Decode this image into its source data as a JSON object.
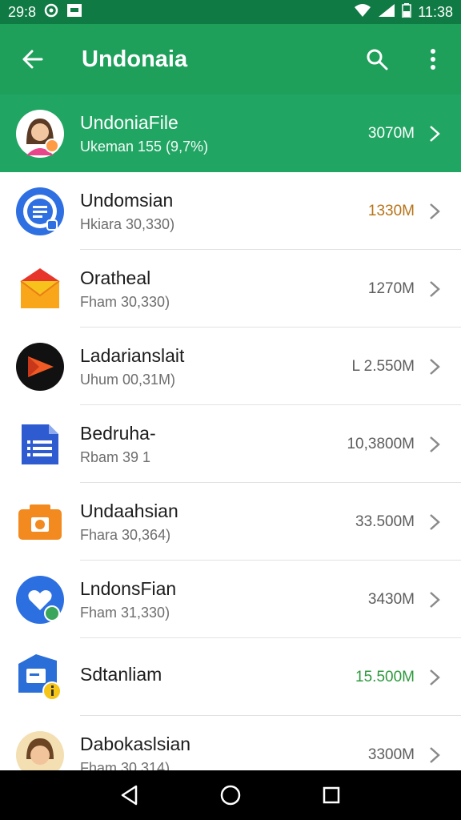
{
  "status": {
    "time_left": "29:8",
    "time_right": "11:38"
  },
  "appbar": {
    "title": "Undonaia"
  },
  "featured": {
    "name": "UndoniaFile",
    "subtitle": "Ukeman 155 (9,7%)",
    "size": "3070M"
  },
  "items": [
    {
      "name": "Undomsian",
      "subtitle": "Hkiara 30,330)",
      "size": "1330M",
      "size_color": "#b8741a",
      "icon": "chat-bubble-icon"
    },
    {
      "name": "Oratheal",
      "subtitle": "Fham 30,330)",
      "size": "1270M",
      "size_color": "#5d5d5d",
      "icon": "mail-envelope-icon"
    },
    {
      "name": "Ladarianslait",
      "subtitle": "Uhum 00,31M)",
      "size": "L 2.550M",
      "size_color": "#5d5d5d",
      "icon": "play-triangle-icon"
    },
    {
      "name": "Bedruha-",
      "subtitle": "Rbam 39 1",
      "size": "10,3800M",
      "size_color": "#5d5d5d",
      "icon": "document-icon"
    },
    {
      "name": "Undaahsian",
      "subtitle": "Fhara 30,364)",
      "size": "33.500M",
      "size_color": "#5d5d5d",
      "icon": "camera-icon"
    },
    {
      "name": "LndonsFian",
      "subtitle": "Fham 31,330)",
      "size": "3430M",
      "size_color": "#5d5d5d",
      "icon": "heart-icon"
    },
    {
      "name": "Sdtanliam",
      "subtitle": "",
      "size": "15.500M",
      "size_color": "#2e9a3e",
      "icon": "folder-info-icon"
    },
    {
      "name": "Dabokaslsian",
      "subtitle": "Fham 30,314)",
      "size": "3300M",
      "size_color": "#5d5d5d",
      "icon": "avatar-boy-icon"
    }
  ]
}
